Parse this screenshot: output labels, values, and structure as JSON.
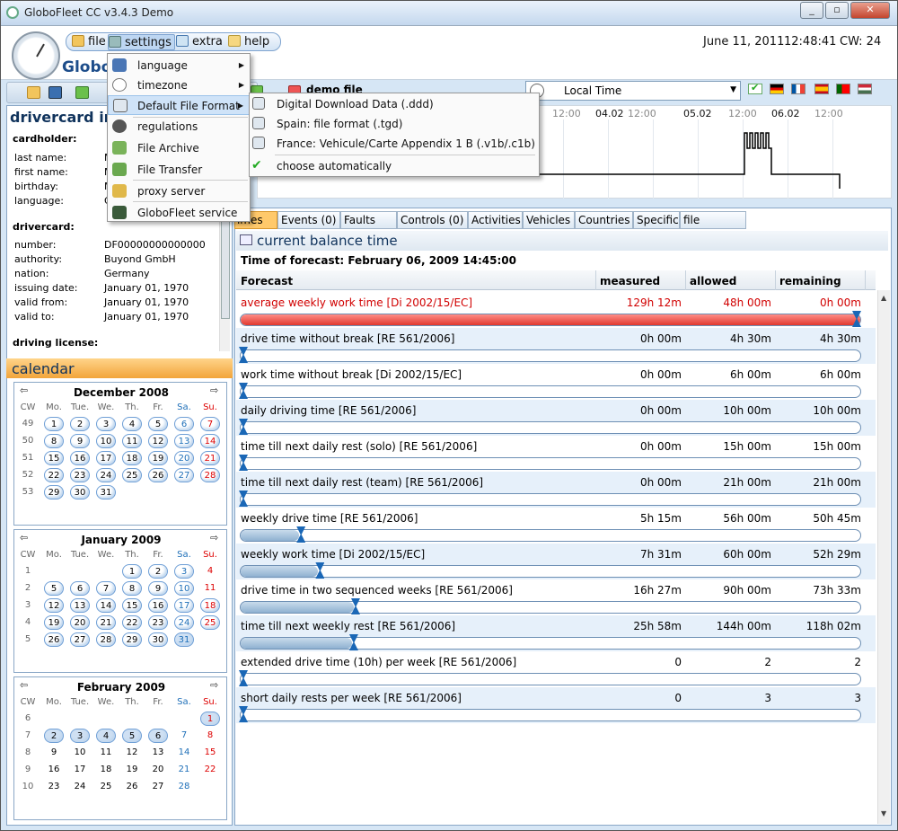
{
  "window": {
    "title": "GloboFleet CC v3.4.3 Demo",
    "brand": "GloboF",
    "controls": [
      "_",
      "▫",
      "✕"
    ]
  },
  "menu": {
    "items": [
      "file",
      "settings",
      "extra",
      "help"
    ],
    "date": "June 11, 2011",
    "time": "12:48:41",
    "cw": "CW: 24"
  },
  "document": {
    "title": "demo file"
  },
  "settings_menu": [
    "language",
    "timezone",
    "Default File Format",
    "regulations",
    "File Archive",
    "File Transfer",
    "proxy server",
    "GloboFleet service"
  ],
  "format_menu": [
    "Digital Download Data (.ddd)",
    "Spain: file format (.tgd)",
    "France: Vehicule/Carte Appendix 1 B (.v1b/.c1b)",
    "choose automatically"
  ],
  "timezone_select": {
    "value": "Local Time"
  },
  "graph": {
    "times": [
      "12:00",
      "12:00",
      "12:00",
      "12:00",
      "12:00",
      "12:00",
      "12:00"
    ],
    "dates": [
      "04.02",
      "05.02",
      "06.02"
    ]
  },
  "drivercard": {
    "title": "drivercard inf",
    "cardholder_h": "cardholder:",
    "labels": [
      "last name:",
      "first name:",
      "birthday:",
      "language:"
    ],
    "values": [
      "M",
      "M",
      "M",
      "G"
    ],
    "drivercard_h": "drivercard:",
    "card_labels": [
      "number:",
      "authority:",
      "nation:",
      "issuing date:",
      "valid from:",
      "valid to:"
    ],
    "card_values": [
      "DF00000000000000",
      "Buyond GmbH",
      "Germany",
      "January 01, 1970",
      "January 01, 1970",
      "January 01, 1970"
    ],
    "license_h": "driving license:"
  },
  "calendar": {
    "title": "calendar",
    "dow": [
      "CW",
      "Mo.",
      "Tue.",
      "We.",
      "Th.",
      "Fr.",
      "Sa.",
      "Su."
    ],
    "months": [
      {
        "name": "December 2008",
        "weeks": [
          [
            "49",
            "1",
            "2",
            "3",
            "4",
            "5",
            "6",
            "7"
          ],
          [
            "50",
            "8",
            "9",
            "10",
            "11",
            "12",
            "13",
            "14"
          ],
          [
            "51",
            "15",
            "16",
            "17",
            "18",
            "19",
            "20",
            "21"
          ],
          [
            "52",
            "22",
            "23",
            "24",
            "25",
            "26",
            "27",
            "28"
          ],
          [
            "53",
            "29",
            "30",
            "31",
            "",
            "",
            "",
            ""
          ]
        ]
      },
      {
        "name": "January 2009",
        "weeks": [
          [
            "1",
            "",
            "",
            "",
            "1",
            "2",
            "3",
            "4"
          ],
          [
            "2",
            "5",
            "6",
            "7",
            "8",
            "9",
            "10",
            "11"
          ],
          [
            "3",
            "12",
            "13",
            "14",
            "15",
            "16",
            "17",
            "18"
          ],
          [
            "4",
            "19",
            "20",
            "21",
            "22",
            "23",
            "24",
            "25"
          ],
          [
            "5",
            "26",
            "27",
            "28",
            "29",
            "30",
            "31",
            ""
          ]
        ]
      },
      {
        "name": "February 2009",
        "weeks": [
          [
            "6",
            "",
            "",
            "",
            "",
            "",
            "",
            "1"
          ],
          [
            "7",
            "2",
            "3",
            "4",
            "5",
            "6",
            "7",
            "8"
          ],
          [
            "8",
            "9",
            "10",
            "11",
            "12",
            "13",
            "14",
            "15"
          ],
          [
            "9",
            "16",
            "17",
            "18",
            "19",
            "20",
            "21",
            "22"
          ],
          [
            "10",
            "23",
            "24",
            "25",
            "26",
            "27",
            "28",
            ""
          ]
        ]
      }
    ]
  },
  "tabs": [
    "Times",
    "Events (0)",
    "Faults (0)",
    "Controls (0)",
    "Activities",
    "Vehicles",
    "Countries",
    "Specific",
    "file content"
  ],
  "balance": {
    "title": "current balance time",
    "forecast_time": "Time of forecast: February 06, 2009 14:45:00",
    "headers": [
      "Forecast",
      "measured",
      "allowed",
      "remaining"
    ],
    "rows": [
      {
        "name": "average weekly work time [Di 2002/15/EC]",
        "measured": "129h 12m",
        "allowed": "48h 00m",
        "remaining": "0h 00m",
        "progress": 1.0,
        "over": true
      },
      {
        "name": "drive time without break [RE 561/2006]",
        "measured": "0h 00m",
        "allowed": "4h 30m",
        "remaining": "4h 30m",
        "progress": 0.0
      },
      {
        "name": "work time without break [Di 2002/15/EC]",
        "measured": "0h 00m",
        "allowed": "6h 00m",
        "remaining": "6h 00m",
        "progress": 0.0
      },
      {
        "name": "daily driving time [RE 561/2006]",
        "measured": "0h 00m",
        "allowed": "10h 00m",
        "remaining": "10h 00m",
        "progress": 0.0
      },
      {
        "name": "time till next daily rest (solo) [RE 561/2006]",
        "measured": "0h 00m",
        "allowed": "15h 00m",
        "remaining": "15h 00m",
        "progress": 0.0
      },
      {
        "name": "time till next daily rest (team) [RE 561/2006]",
        "measured": "0h 00m",
        "allowed": "21h 00m",
        "remaining": "21h 00m",
        "progress": 0.0
      },
      {
        "name": "weekly drive time [RE 561/2006]",
        "measured": "5h 15m",
        "allowed": "56h 00m",
        "remaining": "50h 45m",
        "progress": 0.094
      },
      {
        "name": "weekly work time [Di 2002/15/EC]",
        "measured": "7h 31m",
        "allowed": "60h 00m",
        "remaining": "52h 29m",
        "progress": 0.125
      },
      {
        "name": "drive time in two sequenced weeks [RE 561/2006]",
        "measured": "16h 27m",
        "allowed": "90h 00m",
        "remaining": "73h 33m",
        "progress": 0.183
      },
      {
        "name": "time till next weekly rest [RE 561/2006]",
        "measured": "25h 58m",
        "allowed": "144h 00m",
        "remaining": "118h 02m",
        "progress": 0.18
      },
      {
        "name": "extended drive time (10h) per week [RE 561/2006]",
        "measured": "0",
        "allowed": "2",
        "remaining": "2",
        "progress": 0.0
      },
      {
        "name": "short daily rests per week [RE 561/2006]",
        "measured": "0",
        "allowed": "3",
        "remaining": "3",
        "progress": 0.0
      }
    ]
  }
}
